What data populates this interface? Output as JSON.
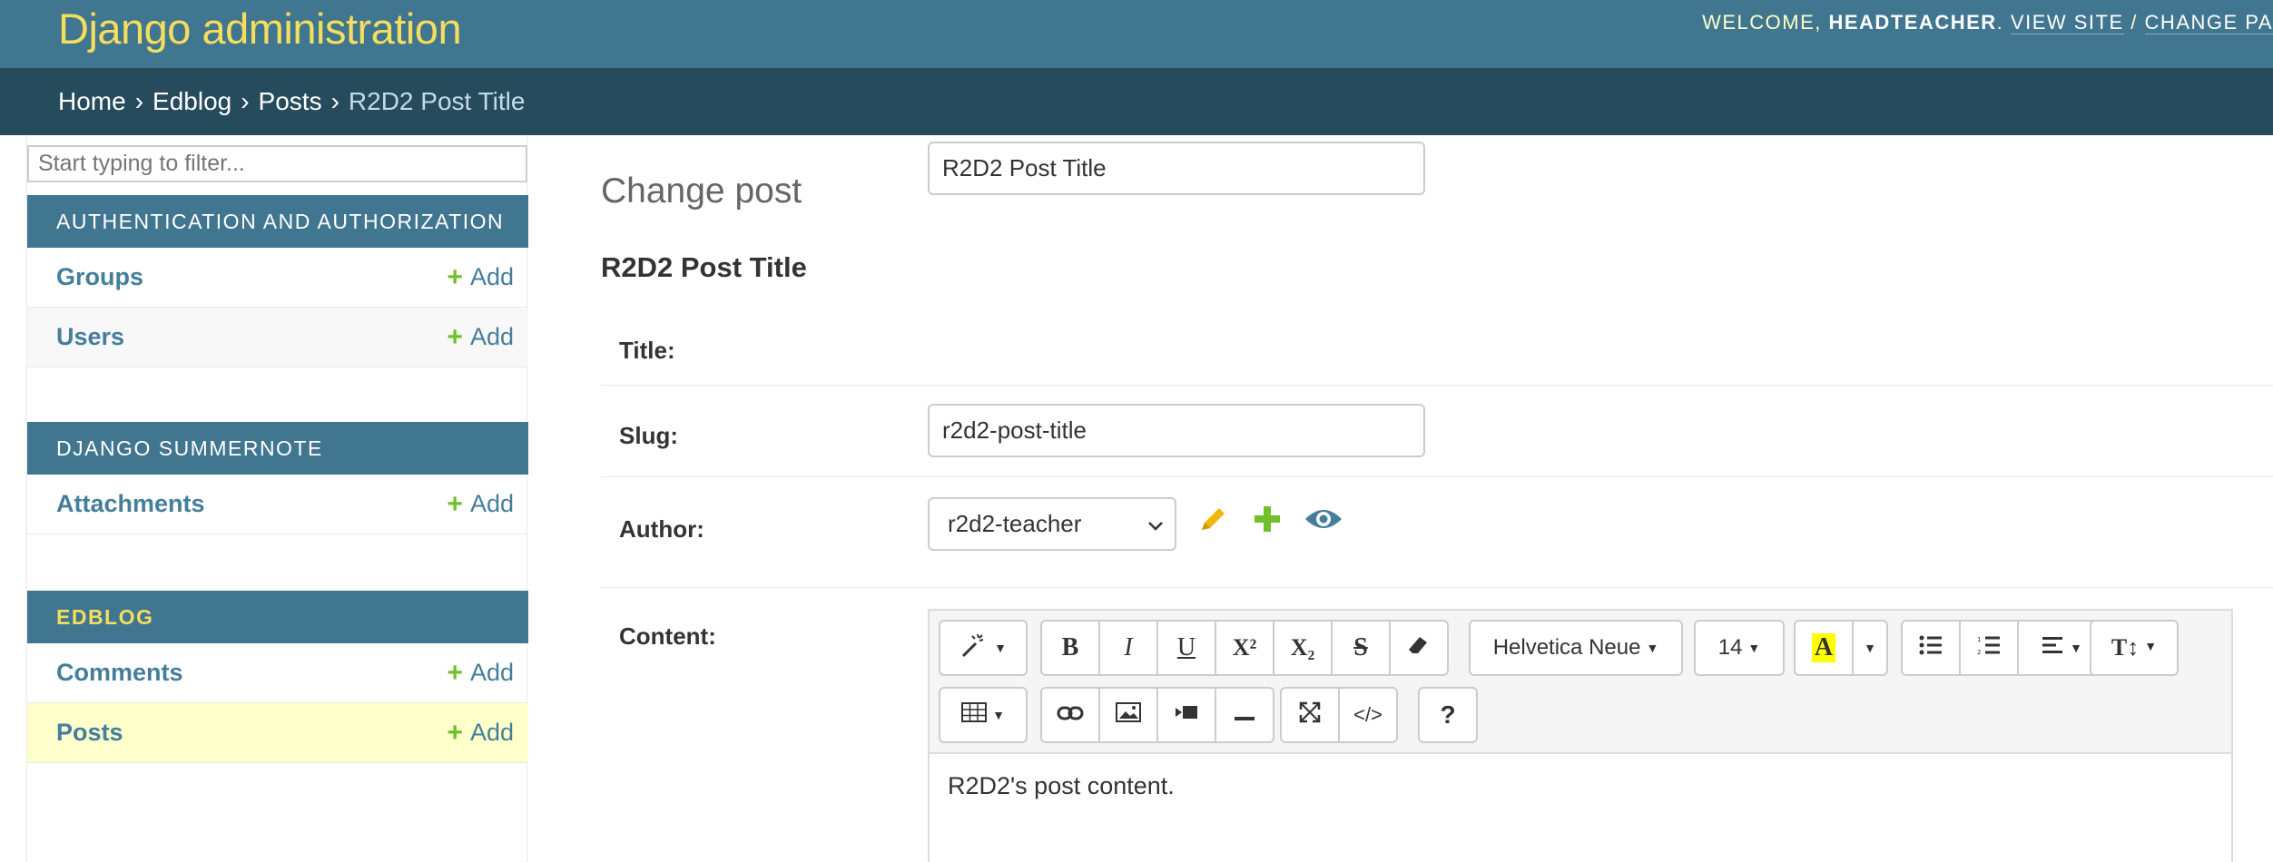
{
  "header": {
    "branding": "Django administration",
    "welcome": "WELCOME,",
    "username": "HEADTEACHER",
    "period": ".",
    "view_site": "VIEW SITE",
    "divider": "/",
    "change_password": "CHANGE PA"
  },
  "breadcrumbs": {
    "items": [
      "Home",
      "Edblog",
      "Posts"
    ],
    "separator": "›",
    "current": "R2D2 Post Title"
  },
  "sidebar": {
    "filter_placeholder": "Start typing to filter...",
    "add_label": "Add",
    "modules": [
      {
        "caption": "AUTHENTICATION AND AUTHORIZATION",
        "models": [
          "Groups",
          "Users"
        ]
      },
      {
        "caption": "DJANGO SUMMERNOTE",
        "models": [
          "Attachments"
        ]
      },
      {
        "caption": "EDBLOG",
        "models": [
          "Comments",
          "Posts"
        ]
      }
    ]
  },
  "content": {
    "title": "Change post",
    "object_title": "R2D2 Post Title",
    "fields": {
      "title": {
        "label": "Title:",
        "value": "R2D2 Post Title"
      },
      "slug": {
        "label": "Slug:",
        "value": "r2d2-post-title"
      },
      "author": {
        "label": "Author:",
        "value": "r2d2-teacher"
      },
      "content": {
        "label": "Content:",
        "value": "R2D2's post content."
      }
    }
  },
  "editor": {
    "font_name": "Helvetica Neue",
    "font_size": "14",
    "highlight_letter": "A",
    "bold": "B",
    "italic": "I",
    "underline": "U",
    "superscript": "X²",
    "subscript": "X₂",
    "strikethrough": "S",
    "code_view": "</>",
    "help": "?",
    "text_height": "T↕"
  },
  "colors": {
    "header_bg": "#417690",
    "breadcrumb_bg": "#264b5d",
    "branding": "#f5dd5d",
    "link": "#447e9b",
    "add_plus": "#70bf2b",
    "active_row": "#ffffcc"
  }
}
